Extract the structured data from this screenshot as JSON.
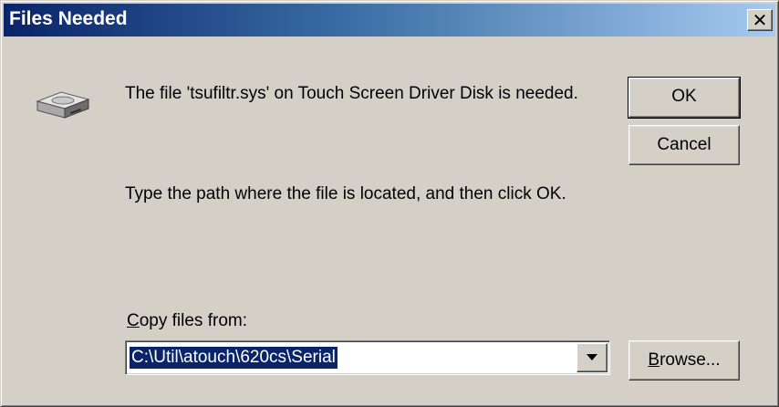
{
  "window": {
    "title": "Files Needed",
    "close_icon": "close-icon"
  },
  "message": {
    "file_needed": "The file 'tsufiltr.sys' on Touch Screen Driver Disk is needed.",
    "instruction": "Type the path where the file is located, and then click OK."
  },
  "copy_from": {
    "label_accel": "C",
    "label_rest": "opy files from:",
    "value": "C:\\Util\\atouch\\620cs\\Serial",
    "dropdown_icon": "chevron-down-icon"
  },
  "buttons": {
    "ok": "OK",
    "cancel": "Cancel",
    "browse_accel": "B",
    "browse_rest": "rowse..."
  },
  "icons": {
    "disk": "disk-drive-icon"
  },
  "colors": {
    "titlebar_start": "#0a246a",
    "titlebar_end": "#a6caf0",
    "dialog_bg": "#d4d0c8",
    "selection": "#0a246a"
  }
}
